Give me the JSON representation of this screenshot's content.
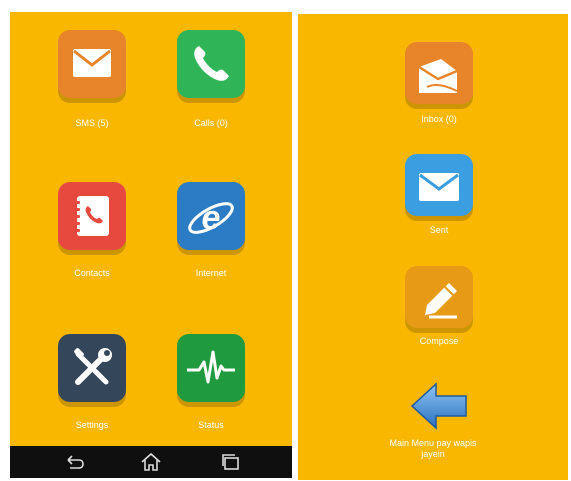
{
  "left_screen": {
    "apps": [
      {
        "label": "SMS (5)",
        "icon": "envelope-icon",
        "color": "#e8842a"
      },
      {
        "label": "Calls (0)",
        "icon": "phone-icon",
        "color": "#2fb457"
      },
      {
        "label": "Contacts",
        "icon": "address-book-icon",
        "color": "#e8493f"
      },
      {
        "label": "Internet",
        "icon": "internet-explorer-icon",
        "color": "#2b7cc4"
      },
      {
        "label": "Settings",
        "icon": "tools-icon",
        "color": "#34465a"
      },
      {
        "label": "Status",
        "icon": "pulse-icon",
        "color": "#1f9a3e"
      }
    ],
    "navbar": {
      "buttons": [
        "back-icon",
        "home-icon",
        "recent-apps-icon"
      ]
    }
  },
  "right_screen": {
    "menu": [
      {
        "label": "Inbox (0)",
        "icon": "open-envelope-icon",
        "color": "#e8842a"
      },
      {
        "label": "Sent",
        "icon": "envelope-icon",
        "color": "#3a9ee0"
      },
      {
        "label": "Compose",
        "icon": "pencil-icon",
        "color": "#e79a15"
      },
      {
        "label": "Main Menu pay wapis jayein",
        "icon": "back-arrow-icon",
        "color": "#3b86d4"
      }
    ]
  },
  "colors": {
    "background": "#f9b700",
    "text": "#ffffff",
    "navbar": "#0f0f0f"
  }
}
